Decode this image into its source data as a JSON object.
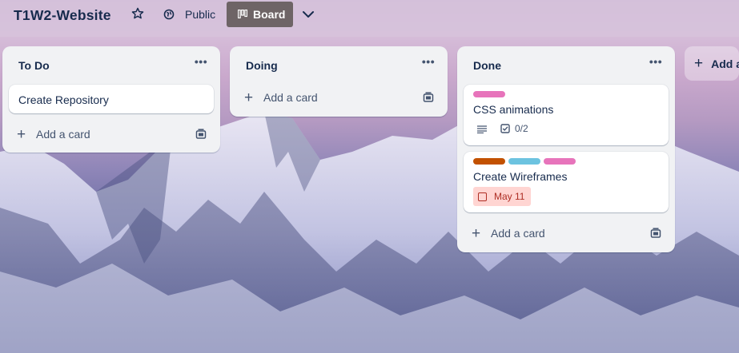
{
  "header": {
    "board_title": "T1W2-Website",
    "star_icon": "star-icon",
    "visibility_icon": "globe-icon",
    "visibility_label": "Public",
    "view_icon": "board-view-icon",
    "view_label": "Board",
    "views_menu_icon": "chevron-down-icon"
  },
  "lists": [
    {
      "title": "To Do",
      "menu_icon": "more-horizontal-icon",
      "cards": [
        {
          "title": "Create Repository"
        }
      ],
      "add_card_label": "Add a card",
      "template_icon": "card-template-icon"
    },
    {
      "title": "Doing",
      "menu_icon": "more-horizontal-icon",
      "cards": [],
      "add_card_label": "Add a card",
      "template_icon": "card-template-icon"
    },
    {
      "title": "Done",
      "menu_icon": "more-horizontal-icon",
      "cards": [
        {
          "title": "CSS animations",
          "labels": [
            {
              "color": "#e774bb"
            }
          ],
          "has_description": true,
          "checklist": "0/2"
        },
        {
          "title": "Create Wireframes",
          "labels": [
            {
              "color": "#c25100"
            },
            {
              "color": "#6cc3e0"
            },
            {
              "color": "#e774bb"
            }
          ],
          "due_date": "May 11",
          "due_status_color": "#ffd5d2"
        }
      ],
      "add_card_label": "Add a card",
      "template_icon": "card-template-icon"
    }
  ],
  "add_list": {
    "label": "Add another list"
  },
  "theme": {
    "header_text": "#172b4d",
    "list_bg": "#f1f2f4",
    "board_button_bg": "#6e6466"
  }
}
